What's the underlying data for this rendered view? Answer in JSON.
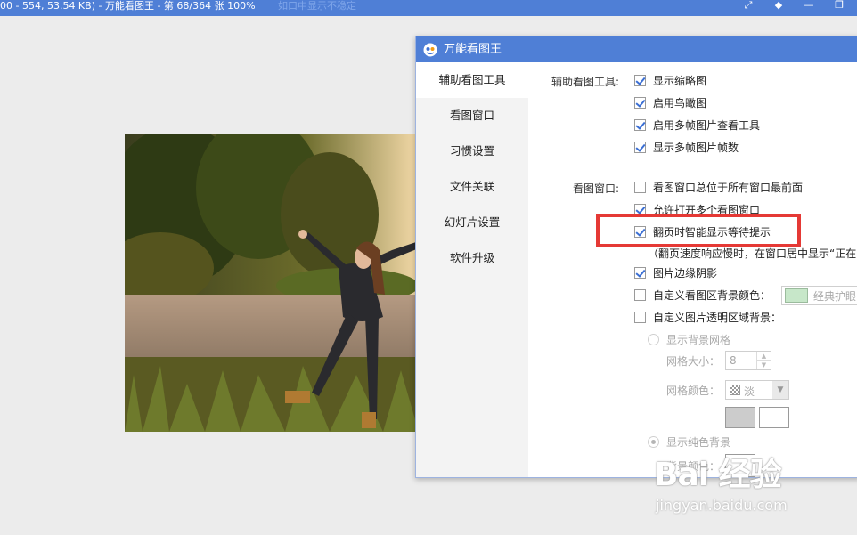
{
  "viewer": {
    "title_bar": "00 - 554, 53.54 KB) - 万能看图王 - 第 68/364 张 100%",
    "ghost_text": "如口中显示不稳定",
    "controls": [
      "⤢",
      "◆",
      "—",
      "❐"
    ]
  },
  "dialog": {
    "title": "万能看图王",
    "sidebar": [
      {
        "label": "辅助看图工具",
        "active": true
      },
      {
        "label": "看图窗口",
        "active": false
      },
      {
        "label": "习惯设置",
        "active": false
      },
      {
        "label": "文件关联",
        "active": false
      },
      {
        "label": "幻灯片设置",
        "active": false
      },
      {
        "label": "软件升级",
        "active": false
      }
    ],
    "group_tools": {
      "label": "辅助看图工具:",
      "options": [
        {
          "label": "显示缩略图",
          "checked": true
        },
        {
          "label": "启用鸟瞰图",
          "checked": true
        },
        {
          "label": "启用多帧图片查看工具",
          "checked": true
        },
        {
          "label": "显示多帧图片帧数",
          "checked": true
        }
      ]
    },
    "group_window": {
      "label": "看图窗口:",
      "options": [
        {
          "label": "看图窗口总位于所有窗口最前面",
          "checked": false
        },
        {
          "label": "允许打开多个看图窗口",
          "checked": true
        },
        {
          "label": "翻页时智能显示等待提示",
          "checked": true
        }
      ],
      "note": "（翻页速度响应慢时，在窗口居中显示“正在",
      "more_options": [
        {
          "label": "图片边缘阴影",
          "checked": true
        },
        {
          "label": "自定义看图区背景颜色：",
          "checked": false
        },
        {
          "label": "自定义图片透明区域背景：",
          "checked": false
        }
      ],
      "bg_color_preset": "经典护眼",
      "bg_color_swatch": "#c7e7c9"
    },
    "transparent_bg": {
      "show_grid_label": "显示背景网格",
      "grid_size_label": "网格大小：",
      "grid_size_value": "8",
      "grid_color_label": "网格颜色：",
      "grid_color_value": "淡",
      "grid_colors": [
        "#cccccc",
        "#ffffff"
      ],
      "solid_bg_label": "显示纯色背景",
      "bg_color_label": "背景颜色："
    }
  },
  "watermark": {
    "brand": "Bai 经验",
    "url": "jingyan.baidu.com"
  },
  "accent_color": "#4f7fd6",
  "highlight_color": "#e53935"
}
